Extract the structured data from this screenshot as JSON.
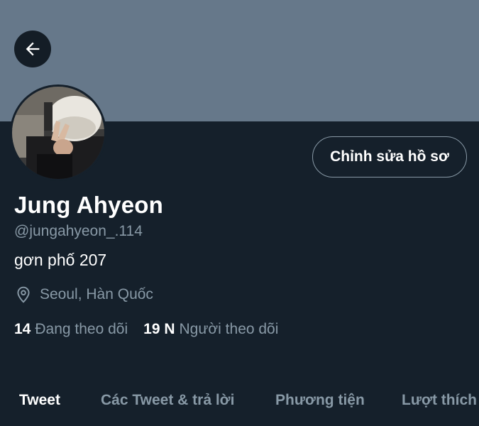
{
  "header": {
    "back_icon": "arrow-left-icon",
    "banner_color": "#66788a"
  },
  "profile": {
    "name": "Jung Ahyeon",
    "handle": "@jungahyeon_.114",
    "bio": "gơn phố 207",
    "location": "Seoul, Hàn Quốc",
    "location_icon": "map-pin-icon",
    "edit_button": "Chỉnh sửa hồ sơ",
    "following_count": "14",
    "following_label": "Đang theo dõi",
    "followers_count": "19 N",
    "followers_label": "Người theo dõi"
  },
  "tabs": [
    {
      "label": "Tweet",
      "active": true
    },
    {
      "label": "Các Tweet & trả lời",
      "active": false
    },
    {
      "label": "Phương tiện",
      "active": false
    },
    {
      "label": "Lượt thích",
      "active": false
    }
  ],
  "colors": {
    "background": "#15202b",
    "secondary_text": "#8899a6",
    "primary_text": "#ffffff"
  }
}
